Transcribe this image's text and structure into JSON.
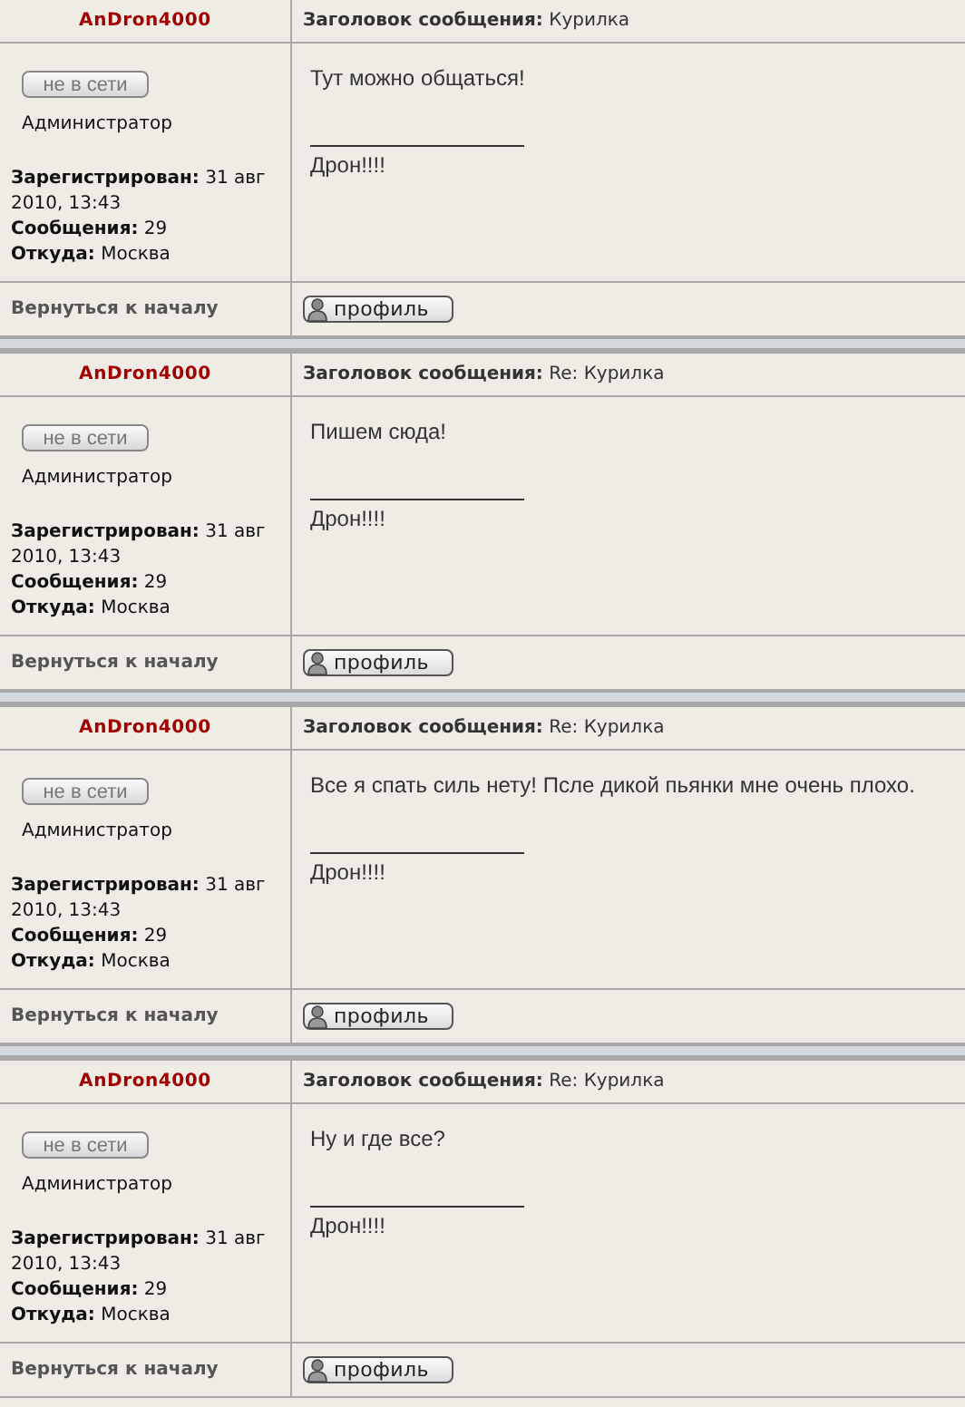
{
  "posts": [
    {
      "author": "AnDron4000",
      "status": "не в сети",
      "rank": "Администратор",
      "registered": "**Зарегистрирован:** 31 авг 2010, 13:43",
      "post_count": "**Сообщения:** 29",
      "location": "**Откуда:** Москва",
      "subject": "**Заголовок сообщения:** Курилка",
      "message": "Тут можно общаться!",
      "signature": "Дрон!!!!",
      "back_link": "Вернуться к началу",
      "profile_button": "профиль"
    },
    {
      "author": "AnDron4000",
      "status": "не в сети",
      "rank": "Администратор",
      "registered": "**Зарегистрирован:** 31 авг 2010, 13:43",
      "post_count": "**Сообщения:** 29",
      "location": "**Откуда:** Москва",
      "subject": "**Заголовок сообщения:** Re: Курилка",
      "message": "Пишем сюда!",
      "signature": "Дрон!!!!",
      "back_link": "Вернуться к началу",
      "profile_button": "профиль"
    },
    {
      "author": "AnDron4000",
      "status": "не в сети",
      "rank": "Администратор",
      "registered": "**Зарегистрирован:** 31 авг 2010, 13:43",
      "post_count": "**Сообщения:** 29",
      "location": "**Откуда:** Москва",
      "subject": "**Заголовок сообщения:** Re: Курилка",
      "message": "Все я спать силь нету! Псле дикой пьянки мне очень плохо.",
      "signature": "Дрон!!!!",
      "back_link": "Вернуться к началу",
      "profile_button": "профиль"
    },
    {
      "author": "AnDron4000",
      "status": "не в сети",
      "rank": "Администратор",
      "registered": "**Зарегистрирован:** 31 авг 2010, 13:43",
      "post_count": "**Сообщения:** 29",
      "location": "**Откуда:** Москва",
      "subject": "**Заголовок сообщения:** Re: Курилка",
      "message": "Ну и где все?",
      "signature": "Дрон!!!!",
      "back_link": "Вернуться к началу",
      "profile_button": "профиль"
    }
  ]
}
